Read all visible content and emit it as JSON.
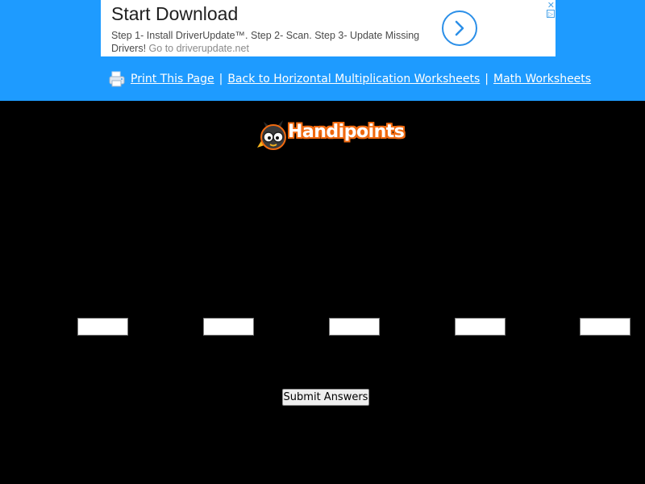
{
  "ad": {
    "title": "Start Download",
    "description": "Step 1- Install DriverUpdate™. Step 2- Scan. Step 3- Update Missing Drivers!",
    "url_text": "Go to driverupdate.net",
    "arrow_icon": "chevron-right-icon",
    "close_symbol": "✕",
    "choices_symbol": "▷"
  },
  "nav": {
    "print_label": "Print This Page",
    "back_label": "Back to Horizontal Multiplication Worksheets",
    "math_label": "Math Worksheets",
    "separator": "|",
    "print_icon": "printer-icon"
  },
  "logo": {
    "text": "Handipoints",
    "icon": "cat-mascot-icon"
  },
  "answers": [
    {
      "value": ""
    },
    {
      "value": ""
    },
    {
      "value": ""
    },
    {
      "value": ""
    },
    {
      "value": ""
    }
  ],
  "submit_label": "Submit Answers",
  "colors": {
    "top_band": "#1e9bff",
    "page_background": "#000000",
    "logo_outline": "#f06a10"
  }
}
